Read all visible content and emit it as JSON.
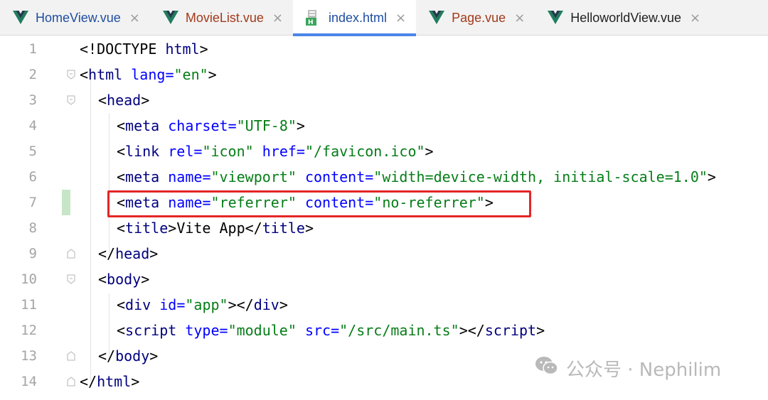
{
  "tabs": [
    {
      "label": "HomeView.vue",
      "icon": "vue-icon",
      "color": "#1f4ea0",
      "active": false
    },
    {
      "label": "MovieList.vue",
      "icon": "vue-icon",
      "color": "#a33a1a",
      "active": false
    },
    {
      "label": "index.html",
      "icon": "html-file-icon",
      "color": "#1f4ea0",
      "active": true
    },
    {
      "label": "Page.vue",
      "icon": "vue-icon",
      "color": "#a33a1a",
      "active": false
    },
    {
      "label": "HelloworldView.vue",
      "icon": "vue-icon",
      "color": "#222222",
      "active": false
    }
  ],
  "close_glyph": "×",
  "editor": {
    "lines": [
      {
        "n": "1"
      },
      {
        "n": "2"
      },
      {
        "n": "3"
      },
      {
        "n": "4"
      },
      {
        "n": "5"
      },
      {
        "n": "6"
      },
      {
        "n": "7"
      },
      {
        "n": "8"
      },
      {
        "n": "9"
      },
      {
        "n": "10"
      },
      {
        "n": "11"
      },
      {
        "n": "12"
      },
      {
        "n": "13"
      },
      {
        "n": "14"
      }
    ],
    "code": {
      "l1": {
        "lt": "<!",
        "kw": "DOCTYPE",
        "sp": " ",
        "tag": "html",
        "gt": ">"
      },
      "l2": {
        "lt": "<",
        "tag": "html",
        "sp": " ",
        "attr": "lang",
        "eq": "=",
        "val": "\"en\"",
        "gt": ">"
      },
      "l3": {
        "lt": "<",
        "tag": "head",
        "gt": ">"
      },
      "l4": {
        "lt": "<",
        "tag": "meta",
        "sp": " ",
        "attr": "charset",
        "eq": "=",
        "val": "\"UTF-8\"",
        "gt": ">"
      },
      "l5": {
        "lt": "<",
        "tag": "link",
        "sp": " ",
        "a1": "rel",
        "eq": "=",
        "v1": "\"icon\"",
        "sp2": " ",
        "a2": "href",
        "v2": "\"/favicon.ico\"",
        "gt": ">"
      },
      "l6": {
        "lt": "<",
        "tag": "meta",
        "sp": " ",
        "a1": "name",
        "eq": "=",
        "v1": "\"viewport\"",
        "sp2": " ",
        "a2": "content",
        "v2": "\"width=device-width, initial-scale=1.0\"",
        "gt": ">"
      },
      "l7": {
        "lt": "<",
        "tag": "meta",
        "sp": " ",
        "a1": "name",
        "eq": "=",
        "v1": "\"referrer\"",
        "sp2": " ",
        "a2": "content",
        "v2": "\"no-referrer\"",
        "gt": ">"
      },
      "l8": {
        "lt": "<",
        "tag": "title",
        "gt": ">",
        "text": "Vite App",
        "clt": "</",
        "ctag": "title"
      },
      "l9": {
        "clt": "</",
        "tag": "head",
        "gt": ">"
      },
      "l10": {
        "lt": "<",
        "tag": "body",
        "gt": ">"
      },
      "l11": {
        "lt": "<",
        "tag": "div",
        "sp": " ",
        "attr": "id",
        "eq": "=",
        "val": "\"app\"",
        "gt": ">",
        "clt": "</",
        "ctag": "div"
      },
      "l12": {
        "lt": "<",
        "tag": "script",
        "sp": " ",
        "a1": "type",
        "eq": "=",
        "v1": "\"module\"",
        "sp2": " ",
        "a2": "src",
        "v2": "\"/src/main.ts\"",
        "gt": ">",
        "clt": "</",
        "ctag": "script"
      },
      "l13": {
        "clt": "</",
        "tag": "body",
        "gt": ">"
      },
      "l14": {
        "clt": "</",
        "tag": "html",
        "gt": ">"
      }
    }
  },
  "colors": {
    "tag": "#00007f",
    "attr": "#0000ff",
    "string": "#067d17",
    "highlight_box": "#e32626",
    "active_tab_underline": "#4a86e8",
    "changed_line_marker": "#c7e6c7"
  },
  "watermark": {
    "text": "公众号 · Nephilim",
    "icon": "wechat-icon"
  }
}
